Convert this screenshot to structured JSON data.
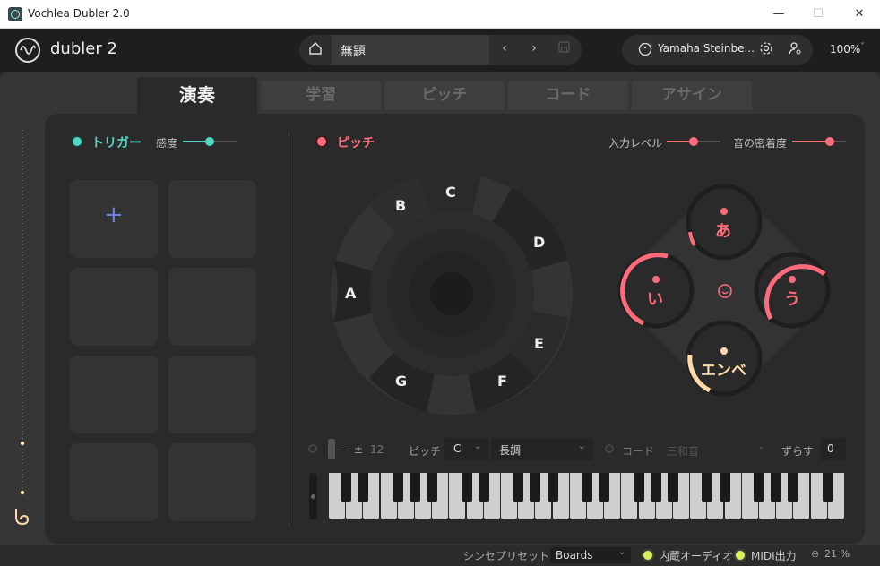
{
  "window": {
    "title": "Vochlea Dubler 2.0",
    "minimize": "—",
    "maximize": "☐",
    "close": "✕"
  },
  "header": {
    "logo": "dubler 2",
    "preset_name": "無題",
    "device": "Yamaha Steinbe...",
    "zoom": "100%",
    "zoom_caret": "˅"
  },
  "tabs": [
    {
      "label": "演奏",
      "active": true
    },
    {
      "label": "学習"
    },
    {
      "label": "ピッチ"
    },
    {
      "label": "コード"
    },
    {
      "label": "アサイン"
    }
  ],
  "trigger": {
    "label": "トリガー",
    "sensitivity_label": "感度",
    "sensitivity": 0.5
  },
  "pitch": {
    "label": "ピッチ",
    "input_level_label": "入力レベル",
    "input_level": 0.5,
    "density_label": "音の密着度",
    "density": 0.7,
    "notes": [
      "C",
      "D",
      "E",
      "F",
      "G",
      "A",
      "B"
    ]
  },
  "vowels": {
    "top": "あ",
    "left": "い",
    "right": "う",
    "bottom": "エンベ"
  },
  "bottom_controls": {
    "octave_minus": "—",
    "plusminus": "±",
    "transpose_value": "12",
    "pitch_label": "ピッチ",
    "key": "C",
    "scale": "長調",
    "chord_label": "コード",
    "chord_type": "三和音",
    "shift_label": "ずらす",
    "shift_value": "0"
  },
  "status": {
    "synth_preset_label": "シンセプリセット",
    "synth_preset": "Boards",
    "internal_audio": "内蔵オーディオ",
    "midi_out": "MIDI出力",
    "cpu": "21 %"
  },
  "colors": {
    "trigger": "#4fd6c4",
    "pitch": "#ff6b7a",
    "env": "#ffd9a8"
  },
  "icons": [
    "home-icon",
    "chevron-left-icon",
    "chevron-right-icon",
    "save-icon",
    "midi-device-icon",
    "gear-icon",
    "user-settings-icon",
    "add-icon",
    "smile-icon",
    "dubler-mic-icon",
    "cpu-icon"
  ]
}
